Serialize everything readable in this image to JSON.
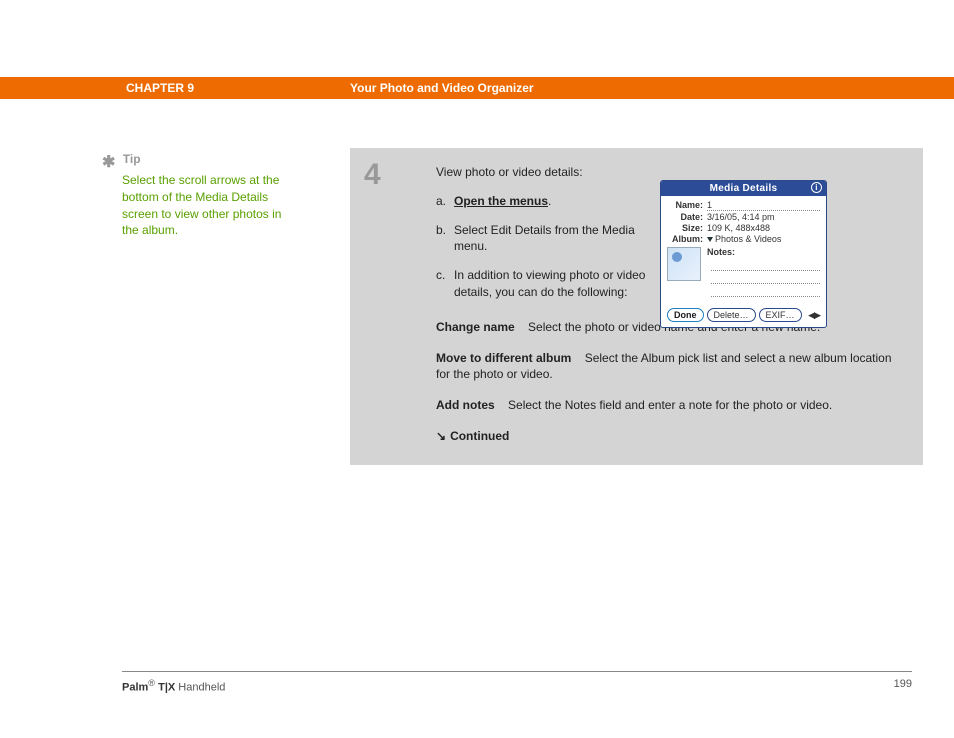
{
  "header": {
    "chapter": "CHAPTER 9",
    "section": "Your Photo and Video Organizer"
  },
  "tip": {
    "asterisk": "✱",
    "label": "Tip",
    "text": "Select the scroll arrows at the bottom of the Media Details screen to view other photos in the album."
  },
  "step": {
    "number": "4",
    "intro": "View photo or video details:",
    "items": {
      "a": {
        "letter": "a.",
        "text_prefix": "",
        "link": "Open the menus",
        "text_suffix": "."
      },
      "b": {
        "letter": "b.",
        "text": "Select Edit Details from the Media menu."
      },
      "c": {
        "letter": "c.",
        "text": "In addition to viewing photo or video details, you can do the following:"
      }
    }
  },
  "details_paras": {
    "p1": {
      "lead": "Change name",
      "body": "Select the photo or video name and enter a new name."
    },
    "p2": {
      "lead": "Move to different album",
      "body": "Select the Album pick list and select a new album location for the photo or video."
    },
    "p3": {
      "lead": "Add notes",
      "body": "Select the Notes field and enter a note for the photo or video."
    }
  },
  "continued": {
    "arrow": "↘",
    "label": "Continued"
  },
  "device": {
    "title": "Media Details",
    "info": "i",
    "rows": {
      "name": {
        "label": "Name:",
        "value": "1"
      },
      "date": {
        "label": "Date:",
        "value": "3/16/05, 4:14 pm"
      },
      "size": {
        "label": "Size:",
        "value": "109 K, 488x488"
      },
      "album": {
        "label": "Album:",
        "value": "Photos & Videos"
      },
      "notes": {
        "label": "Notes:"
      }
    },
    "buttons": {
      "done": "Done",
      "delete": "Delete…",
      "exif": "EXIF…"
    },
    "nav": "◀▶"
  },
  "footer": {
    "brand_pre": "Palm",
    "brand_sup": "®",
    "brand_mid": " T|X",
    "brand_rest": " Handheld",
    "page": "199"
  }
}
